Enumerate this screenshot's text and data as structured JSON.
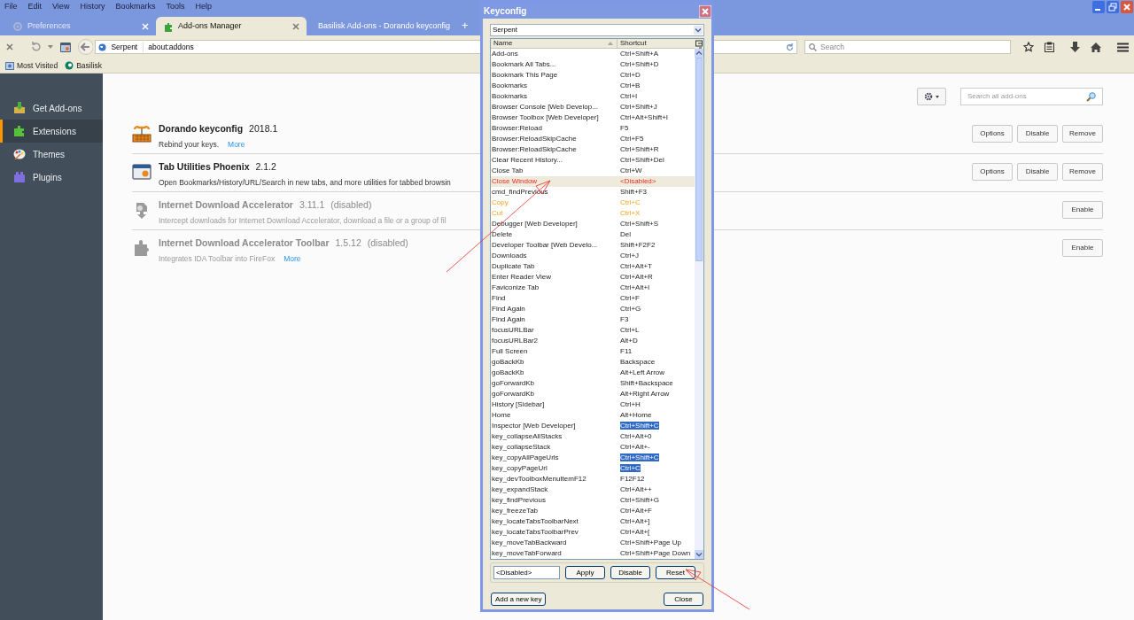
{
  "menu_bar": [
    "File",
    "Edit",
    "View",
    "History",
    "Bookmarks",
    "Tools",
    "Help"
  ],
  "tabs": [
    {
      "label": "Preferences",
      "selected": false,
      "dimmed": true
    },
    {
      "label": "Add-ons Manager",
      "selected": true,
      "dimmed": false
    },
    {
      "label": "Basilisk Add-ons - Dorando keyconfig",
      "selected": false,
      "dimmed": false
    }
  ],
  "new_tab": "+",
  "nav_bar": {
    "identity": "Serpent",
    "url": "about:addons",
    "search_placeholder": "Search"
  },
  "bookmarks": [
    "Most Visited",
    "Basilisk"
  ],
  "sidebar": [
    {
      "label": "Get Add-ons",
      "selected": false
    },
    {
      "label": "Extensions",
      "selected": true
    },
    {
      "label": "Themes",
      "selected": false
    },
    {
      "label": "Plugins",
      "selected": false
    }
  ],
  "addons_search": {
    "placeholder": "Search all add-ons"
  },
  "addons": [
    {
      "name": "Dorando keyconfig",
      "version": "2018.1",
      "description": "Rebind your keys.",
      "more": "More",
      "disabled": false,
      "buttons": [
        "Options",
        "Disable",
        "Remove"
      ]
    },
    {
      "name": "Tab Utilities Phoenix",
      "version": "2.1.2",
      "description": "Open Bookmarks/History/URL/Search in new tabs, and more utilities for tabbed browsin",
      "disabled": false,
      "buttons": [
        "Options",
        "Disable",
        "Remove"
      ]
    },
    {
      "name": "Internet Download Accelerator",
      "version": "3.11.1",
      "status": "(disabled)",
      "description": "Intercept downloads for Internet Download Accelerator, download a file or a group of fil",
      "disabled": true,
      "buttons": [
        "Enable"
      ]
    },
    {
      "name": "Internet Download Accelerator Toolbar",
      "version": "1.5.12",
      "status": "(disabled)",
      "description": "Integrates IDA Toolbar into FireFox",
      "more": "More",
      "disabled": true,
      "buttons": [
        "Enable"
      ]
    }
  ],
  "dialog": {
    "title": "Keyconfig",
    "profile": "Serpent",
    "columns": [
      "Name",
      "Shortcut"
    ],
    "rows": [
      {
        "name": "Add-ons",
        "shortcut": "Ctrl+Shift+A",
        "kind": "normal",
        "selected": false
      },
      {
        "name": "Bookmark All Tabs...",
        "shortcut": "Ctrl+Shift+D",
        "kind": "normal",
        "selected": false
      },
      {
        "name": "Bookmark This Page",
        "shortcut": "Ctrl+D",
        "kind": "normal",
        "selected": false
      },
      {
        "name": "Bookmarks",
        "shortcut": "Ctrl+B",
        "kind": "normal",
        "selected": false
      },
      {
        "name": "Bookmarks",
        "shortcut": "Ctrl+I",
        "kind": "normal",
        "selected": false
      },
      {
        "name": "Browser Console [Web Develop...",
        "shortcut": "Ctrl+Shift+J",
        "kind": "normal",
        "selected": false
      },
      {
        "name": "Browser Toolbox [Web Developer]",
        "shortcut": "Ctrl+Alt+Shift+I",
        "kind": "normal",
        "selected": false
      },
      {
        "name": "Browser:Reload",
        "shortcut": "F5",
        "kind": "normal",
        "selected": false
      },
      {
        "name": "Browser:ReloadSkipCache",
        "shortcut": "Ctrl+F5",
        "kind": "normal",
        "selected": false
      },
      {
        "name": "Browser:ReloadSkipCache",
        "shortcut": "Ctrl+Shift+R",
        "kind": "normal",
        "selected": false
      },
      {
        "name": "Clear Recent History...",
        "shortcut": "Ctrl+Shift+Del",
        "kind": "normal",
        "selected": false
      },
      {
        "name": "Close Tab",
        "shortcut": "Ctrl+W",
        "kind": "normal",
        "selected": false
      },
      {
        "name": "Close Window",
        "shortcut": "<Disabled>",
        "kind": "disabled",
        "selected": true
      },
      {
        "name": "cmd_findPrevious",
        "shortcut": "Shift+F3",
        "kind": "normal",
        "selected": false
      },
      {
        "name": "Copy",
        "shortcut": "Ctrl+C",
        "kind": "conflict",
        "selected": false
      },
      {
        "name": "Cut",
        "shortcut": "Ctrl+X",
        "kind": "conflict",
        "selected": false
      },
      {
        "name": "Debugger [Web Developer]",
        "shortcut": "Ctrl+Shift+S",
        "kind": "normal",
        "selected": false
      },
      {
        "name": "Delete",
        "shortcut": "Del",
        "kind": "normal",
        "selected": false
      },
      {
        "name": "Developer Toolbar [Web Develo...",
        "shortcut": "Shift+F2F2",
        "kind": "normal",
        "selected": false
      },
      {
        "name": "Downloads",
        "shortcut": "Ctrl+J",
        "kind": "normal",
        "selected": false
      },
      {
        "name": "Duplicate Tab",
        "shortcut": "Ctrl+Alt+T",
        "kind": "normal",
        "selected": false
      },
      {
        "name": "Enter Reader View",
        "shortcut": "Ctrl+Alt+R",
        "kind": "normal",
        "selected": false
      },
      {
        "name": "Faviconize Tab",
        "shortcut": "Ctrl+Alt+I",
        "kind": "normal",
        "selected": false
      },
      {
        "name": "Find",
        "shortcut": "Ctrl+F",
        "kind": "normal",
        "selected": false
      },
      {
        "name": "Find Again",
        "shortcut": "Ctrl+G",
        "kind": "normal",
        "selected": false
      },
      {
        "name": "Find Again",
        "shortcut": "F3",
        "kind": "normal",
        "selected": false
      },
      {
        "name": "focusURLBar",
        "shortcut": "Ctrl+L",
        "kind": "normal",
        "selected": false
      },
      {
        "name": "focusURLBar2",
        "shortcut": "Alt+D",
        "kind": "normal",
        "selected": false
      },
      {
        "name": "Full Screen",
        "shortcut": "F11",
        "kind": "normal",
        "selected": false
      },
      {
        "name": "goBackKb",
        "shortcut": "Backspace",
        "kind": "normal",
        "selected": false
      },
      {
        "name": "goBackKb",
        "shortcut": "Alt+Left Arrow",
        "kind": "normal",
        "selected": false
      },
      {
        "name": "goForwardKb",
        "shortcut": "Shift+Backspace",
        "kind": "normal",
        "selected": false
      },
      {
        "name": "goForwardKb",
        "shortcut": "Alt+Right Arrow",
        "kind": "normal",
        "selected": false
      },
      {
        "name": "History [Sidebar]",
        "shortcut": "Ctrl+H",
        "kind": "normal",
        "selected": false
      },
      {
        "name": "Home",
        "shortcut": "Alt+Home",
        "kind": "normal",
        "selected": false
      },
      {
        "name": "Inspector [Web Developer]",
        "shortcut": "Ctrl+Shift+C",
        "kind": "marked",
        "selected": false
      },
      {
        "name": "key_collapseAllStacks",
        "shortcut": "Ctrl+Alt+0",
        "kind": "normal",
        "selected": false
      },
      {
        "name": "key_collapseStack",
        "shortcut": "Ctrl+Alt+-",
        "kind": "normal",
        "selected": false
      },
      {
        "name": "key_copyAllPageUrls",
        "shortcut": "Ctrl+Shift+C",
        "kind": "marked",
        "selected": false
      },
      {
        "name": "key_copyPageUrl",
        "shortcut": "Ctrl+C",
        "kind": "marked",
        "selected": false
      },
      {
        "name": "key_devToolboxMenuItemF12",
        "shortcut": "F12F12",
        "kind": "normal",
        "selected": false
      },
      {
        "name": "key_expandStack",
        "shortcut": "Ctrl+Alt++",
        "kind": "normal",
        "selected": false
      },
      {
        "name": "key_findPrevious",
        "shortcut": "Ctrl+Shift+G",
        "kind": "normal",
        "selected": false
      },
      {
        "name": "key_freezeTab",
        "shortcut": "Ctrl+Alt+F",
        "kind": "normal",
        "selected": false
      },
      {
        "name": "key_locateTabsToolbarNext",
        "shortcut": "Ctrl+Alt+]",
        "kind": "normal",
        "selected": false
      },
      {
        "name": "key_locateTabsToolbarPrev",
        "shortcut": "Ctrl+Alt+[",
        "kind": "normal",
        "selected": false
      },
      {
        "name": "key_moveTabBackward",
        "shortcut": "Ctrl+Shift+Page Up",
        "kind": "normal",
        "selected": false
      },
      {
        "name": "key_moveTabForward",
        "shortcut": "Ctrl+Shift+Page Down",
        "kind": "normal",
        "selected": false
      }
    ],
    "key_value": "<Disabled>",
    "edit_buttons": [
      "Apply",
      "Disable",
      "Reset"
    ],
    "add_button": "Add a new key",
    "close_button": "Close"
  }
}
